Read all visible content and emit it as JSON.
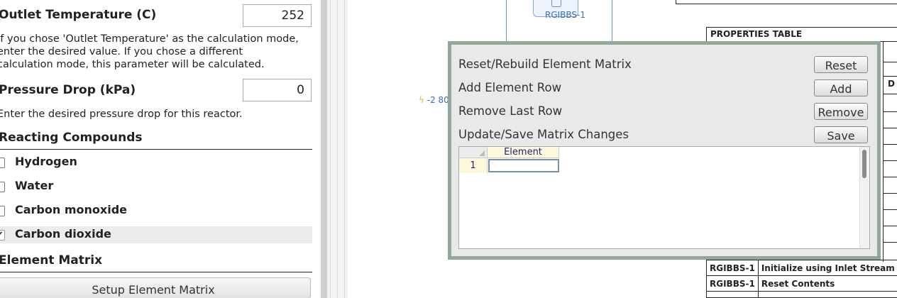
{
  "left_panel": {
    "outlet_temp": {
      "label": "Outlet Temperature (C)",
      "value": "252",
      "description_lines": [
        "If you chose 'Outlet Temperature' as the calculation mode,",
        "enter the desired value. If you chose a different",
        "calculation mode, this parameter will be calculated."
      ]
    },
    "pressure_drop": {
      "label": "Pressure Drop (kPa)",
      "value": "0",
      "description": "Enter the desired pressure drop for this reactor."
    },
    "reacting_compounds": {
      "heading": "Reacting Compounds",
      "items": [
        {
          "label": "Hydrogen",
          "checked": false,
          "mark": ""
        },
        {
          "label": "Water",
          "checked": false,
          "mark": ""
        },
        {
          "label": "Carbon monoxide",
          "checked": false,
          "mark": ""
        },
        {
          "label": "Carbon dioxide",
          "checked": true,
          "mark": "✔"
        }
      ]
    },
    "element_matrix": {
      "heading": "Element Matrix",
      "setup_button": "Setup Element Matrix"
    }
  },
  "canvas": {
    "block_label": "RGIBBS-1",
    "energy_label": "-2 80",
    "properties_table_title": "PROPERTIES TABLE",
    "side_letter": "D",
    "bottom_rows": [
      {
        "block": "RGIBBS-1",
        "action": "Initialize using Inlet Stream"
      },
      {
        "block": "RGIBBS-1",
        "action": "Reset Contents"
      }
    ]
  },
  "dialog": {
    "actions": [
      {
        "label": "Reset/Rebuild Element Matrix",
        "button": "Reset"
      },
      {
        "label": "Add Element Row",
        "button": "Add"
      },
      {
        "label": "Remove Last Row",
        "button": "Remove"
      },
      {
        "label": "Update/Save Matrix Changes",
        "button": "Save"
      }
    ],
    "grid": {
      "column_header": "Element",
      "rows": [
        {
          "number": "1",
          "value": ""
        }
      ]
    }
  }
}
